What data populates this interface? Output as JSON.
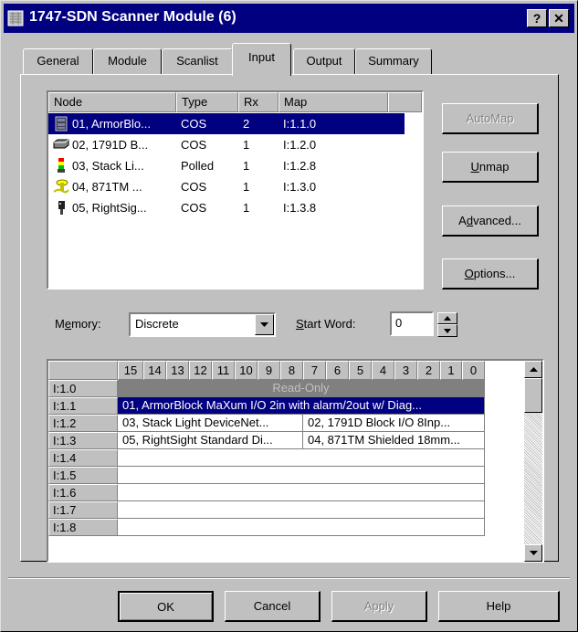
{
  "window": {
    "title": "1747-SDN Scanner Module (6)",
    "help_button": "?",
    "close_button": "✕"
  },
  "tabs": [
    {
      "label": "General"
    },
    {
      "label": "Module"
    },
    {
      "label": "Scanlist"
    },
    {
      "label": "Input",
      "active": true
    },
    {
      "label": "Output"
    },
    {
      "label": "Summary"
    }
  ],
  "device_list": {
    "columns": [
      "Node",
      "Type",
      "Rx",
      "Map"
    ],
    "rows": [
      {
        "node": "01, ArmorBlo...",
        "type": "COS",
        "rx": "2",
        "map": "I:1.1.0",
        "icon": "armorblock-icon",
        "selected": true
      },
      {
        "node": "02, 1791D B...",
        "type": "COS",
        "rx": "1",
        "map": "I:1.2.0",
        "icon": "io-block-icon"
      },
      {
        "node": "03, Stack Li...",
        "type": "Polled",
        "rx": "1",
        "map": "I:1.2.8",
        "icon": "stack-light-icon"
      },
      {
        "node": "04, 871TM ...",
        "type": "COS",
        "rx": "1",
        "map": "I:1.3.0",
        "icon": "prox-sensor-icon"
      },
      {
        "node": "05, RightSig...",
        "type": "COS",
        "rx": "1",
        "map": "I:1.3.8",
        "icon": "photo-sensor-icon"
      }
    ]
  },
  "side_buttons": {
    "automap": "AutoMap",
    "unmap": "Unmap",
    "advanced": "Advanced...",
    "options": "Options..."
  },
  "memory": {
    "label": "Memory:",
    "value": "Discrete"
  },
  "start_word": {
    "label": "Start Word:",
    "value": "0"
  },
  "bit_grid": {
    "bit_headers": [
      "15",
      "14",
      "13",
      "12",
      "11",
      "10",
      "9",
      "8",
      "7",
      "6",
      "5",
      "4",
      "3",
      "2",
      "1",
      "0"
    ],
    "rows": [
      {
        "label": "I:1.0",
        "cells": [
          {
            "text": "Read-Only",
            "style": "readonly",
            "span": 16
          }
        ]
      },
      {
        "label": "I:1.1",
        "cells": [
          {
            "text": "01, ArmorBlock MaXum I/O  2in with alarm/2out w/ Diag...",
            "style": "selected",
            "span": 16
          }
        ]
      },
      {
        "label": "I:1.2",
        "cells": [
          {
            "text": "03, Stack Light DeviceNet...",
            "span": 8
          },
          {
            "text": "02, 1791D Block I/O 8Inp...",
            "span": 8
          }
        ]
      },
      {
        "label": "I:1.3",
        "cells": [
          {
            "text": "05, RightSight Standard Di...",
            "span": 8
          },
          {
            "text": "04, 871TM Shielded 18mm...",
            "span": 8
          }
        ]
      },
      {
        "label": "I:1.4",
        "cells": []
      },
      {
        "label": "I:1.5",
        "cells": []
      },
      {
        "label": "I:1.6",
        "cells": []
      },
      {
        "label": "I:1.7",
        "cells": []
      },
      {
        "label": "I:1.8",
        "cells": []
      }
    ]
  },
  "footer_buttons": {
    "ok": "OK",
    "cancel": "Cancel",
    "apply": "Apply",
    "help": "Help"
  },
  "colors": {
    "selection": "#000080",
    "face": "#c0c0c0",
    "readonly": "#808080"
  }
}
